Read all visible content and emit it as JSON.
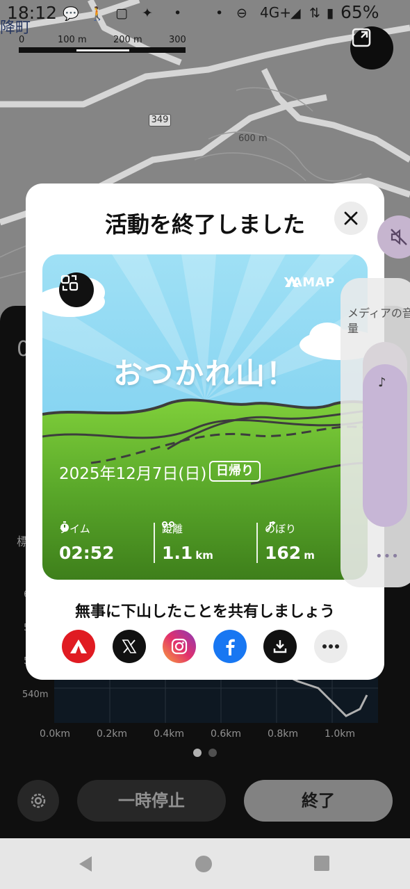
{
  "status_bar": {
    "time": "18:12",
    "network": "4G+",
    "battery": "65%"
  },
  "map": {
    "scale_labels": [
      "0",
      "100 m",
      "200 m",
      "300 m"
    ],
    "town_fragment": "降町",
    "road_number": "349",
    "contour_label": "600 m"
  },
  "modal": {
    "title": "活動を終了しました",
    "card": {
      "brand": "YAMAP",
      "headline": "おつかれ山！",
      "date": "2025年12月7日(日)",
      "badge": "日帰り",
      "stats": [
        {
          "label": "タイム",
          "value": "02:52",
          "unit": ""
        },
        {
          "label": "距離",
          "value": "1.1",
          "unit": "km"
        },
        {
          "label": "のぼり",
          "value": "162",
          "unit": "m"
        }
      ]
    },
    "share_prompt": "無事に下山したことを共有しましょう",
    "share_targets": [
      "yamap-share",
      "x-share",
      "instagram-share",
      "facebook-share",
      "download",
      "more"
    ]
  },
  "volume_panel": {
    "label": "メディアの音量",
    "level": 0.88,
    "more": "•••"
  },
  "bottom_panel": {
    "left_digit": "0",
    "left_label": "標",
    "y_labels": [
      "6",
      "5",
      "5",
      "540m"
    ],
    "x_labels": [
      "0.0km",
      "0.2km",
      "0.4km",
      "0.6km",
      "0.8km",
      "1.0km"
    ],
    "pause_label": "一時停止",
    "finish_label": "終了"
  },
  "colors": {
    "card_sky": "#7fd0ef",
    "card_grass": "#6fbf3a",
    "yamap_red": "#e01b22",
    "facebook_blue": "#1877f2",
    "volume_fill": "#c7b6d6"
  }
}
